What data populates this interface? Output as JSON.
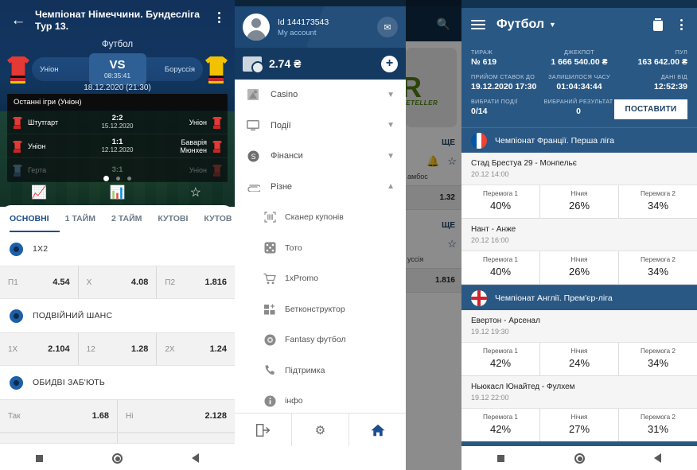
{
  "panel_left": {
    "header": {
      "title_line1": "Чемпіонат Німеччини. Бундесліга",
      "title_line2": "Тур 13.",
      "back_icon": "back-arrow-icon",
      "menu_icon": "kebab-menu-icon"
    },
    "sport": "Футбол",
    "match": {
      "home_team": "Уніон",
      "away_team": "Боруссія",
      "vs": "VS",
      "countdown": "08:35:41",
      "datetime": "18.12.2020 (21:30)",
      "home_color": "#e53935",
      "away_color": "#f2c200"
    },
    "last_games": {
      "title": "Останні ігри (Уніон)",
      "rows": [
        {
          "home": "Штутгарт",
          "score": "2:2",
          "date": "15.12.2020",
          "away": "Уніон"
        },
        {
          "home": "Уніон",
          "score": "1:1",
          "date": "12.12.2020",
          "away": "Баварія Мюнхен"
        },
        {
          "home": "Герта",
          "score": "3:1",
          "date": "",
          "away": "Уніон"
        }
      ]
    },
    "hero_icons": [
      "trend-line-icon",
      "bar-chart-icon",
      "star-icon"
    ],
    "tabs": [
      {
        "label": "ОСНОВНІ",
        "active": true
      },
      {
        "label": "1 ТАЙМ",
        "active": false
      },
      {
        "label": "2 ТАЙМ",
        "active": false
      },
      {
        "label": "КУТОВІ",
        "active": false
      },
      {
        "label": "КУТОВ",
        "active": false
      }
    ],
    "markets": [
      {
        "name": "1X2",
        "outcomes": [
          {
            "key": "П1",
            "value": "4.54"
          },
          {
            "key": "X",
            "value": "4.08"
          },
          {
            "key": "П2",
            "value": "1.816"
          }
        ]
      },
      {
        "name": "ПОДВІЙНИЙ ШАНС",
        "outcomes": [
          {
            "key": "1X",
            "value": "2.104"
          },
          {
            "key": "12",
            "value": "1.28"
          },
          {
            "key": "2X",
            "value": "1.24"
          }
        ]
      },
      {
        "name": "ОБИДВІ ЗАБ'ЮТЬ",
        "outcomes": [
          {
            "key": "Так",
            "value": "1.68"
          },
          {
            "key": "Ні",
            "value": "2.128"
          }
        ]
      }
    ]
  },
  "panel_drawer": {
    "account": {
      "id": "Id 144173543",
      "subtitle": "My account",
      "mail_icon": "envelope-icon",
      "avatar_icon": "avatar-icon"
    },
    "balance": {
      "amount": "2.74 ₴",
      "add_icon": "plus-icon",
      "wallet_icon": "wallet-icon"
    },
    "items": [
      {
        "label": "Casino",
        "icon": "casino-icon",
        "expandable": true,
        "expanded": false
      },
      {
        "label": "Події",
        "icon": "monitor-icon",
        "expandable": true,
        "expanded": false
      },
      {
        "label": "Фінанси",
        "icon": "coin-icon",
        "expandable": true,
        "expanded": false
      },
      {
        "label": "Різне",
        "icon": "paperclip-icon",
        "expandable": true,
        "expanded": true
      }
    ],
    "sub_items": [
      {
        "label": "Сканер купонів",
        "icon": "barcode-scanner-icon"
      },
      {
        "label": "Тото",
        "icon": "dice-icon"
      },
      {
        "label": "1xPromo",
        "icon": "shopping-cart-icon"
      },
      {
        "label": "Бетконструктор",
        "icon": "grid-plus-icon"
      },
      {
        "label": "Fantasy футбол",
        "icon": "target-icon"
      },
      {
        "label": "Підтримка",
        "icon": "phone-icon"
      },
      {
        "label": "інфо",
        "icon": "info-icon"
      }
    ],
    "footer": [
      {
        "icon": "logout-icon"
      },
      {
        "icon": "gear-icon"
      },
      {
        "icon": "home-icon"
      }
    ]
  },
  "panel_background": {
    "search_icon": "search-icon",
    "brand": "R",
    "brand_sub": "NETELLER",
    "more": "ЩЕ",
    "icons": [
      "bell-icon",
      "star-icon"
    ],
    "text_fragment": "амбос",
    "odds": [
      "1.32",
      "1.816"
    ]
  },
  "panel_right": {
    "header": {
      "title": "Футбол",
      "burger_icon": "hamburger-menu-icon",
      "caret_icon": "chevron-down-icon",
      "trash_icon": "trash-icon",
      "menu_icon": "kebab-menu-icon"
    },
    "info": {
      "draw_label": "ТИРАЖ",
      "draw_value": "№ 619",
      "jackpot_label": "ДЖЕКПОТ",
      "jackpot_value": "1 666 540.00 ₴",
      "pool_label": "ПУЛ",
      "pool_value": "163 642.00 ₴",
      "accept_label": "ПРИЙОМ СТАВОК ДО",
      "accept_value": "19.12.2020 17:30",
      "remaining_label": "ЗАЛИШИЛОСЯ ЧАСУ",
      "remaining_value": "01:04:34:44",
      "data_label": "ДАНІ ВІД",
      "data_value": "12:52:39",
      "selected_label": "ВИБРАТИ ПОДІЇ",
      "selected_value": "0/14",
      "result_label": "ВИБРАНИЙ РЕЗУЛЬТАТ",
      "result_value": "0",
      "bet_button": "ПОСТАВИТИ"
    },
    "leagues": [
      {
        "name": "Чемпіонат Франції. Перша ліга",
        "flag": "fr",
        "events": [
          {
            "teams": "Стад Брестуа 29 - Монпельє",
            "date": "20.12 14:00",
            "outcomes": [
              {
                "label": "Перемога 1",
                "value": "40%"
              },
              {
                "label": "Нічия",
                "value": "26%"
              },
              {
                "label": "Перемога 2",
                "value": "34%"
              }
            ]
          },
          {
            "teams": "Нант - Анже",
            "date": "20.12 16:00",
            "outcomes": [
              {
                "label": "Перемога 1",
                "value": "40%"
              },
              {
                "label": "Нічия",
                "value": "26%"
              },
              {
                "label": "Перемога 2",
                "value": "34%"
              }
            ]
          }
        ]
      },
      {
        "name": "Чемпіонат Англії. Прем'єр-ліга",
        "flag": "en",
        "events": [
          {
            "teams": "Евертон - Арсенал",
            "date": "19.12 19:30",
            "outcomes": [
              {
                "label": "Перемога 1",
                "value": "42%"
              },
              {
                "label": "Нічия",
                "value": "24%"
              },
              {
                "label": "Перемога 2",
                "value": "34%"
              }
            ]
          },
          {
            "teams": "Ньюкасл Юнайтед - Фулхем",
            "date": "19.12 22:00",
            "outcomes": [
              {
                "label": "Перемога 1",
                "value": "42%"
              },
              {
                "label": "Нічия",
                "value": "27%"
              },
              {
                "label": "Перемога 2",
                "value": "31%"
              }
            ]
          }
        ]
      }
    ]
  },
  "android_nav": {
    "recents": "square-icon",
    "home": "circle-icon",
    "back": "triangle-back-icon"
  },
  "colors": {
    "brand_blue": "#2a5884",
    "dark_blue": "#143a61",
    "accent": "#1d4e8f"
  }
}
